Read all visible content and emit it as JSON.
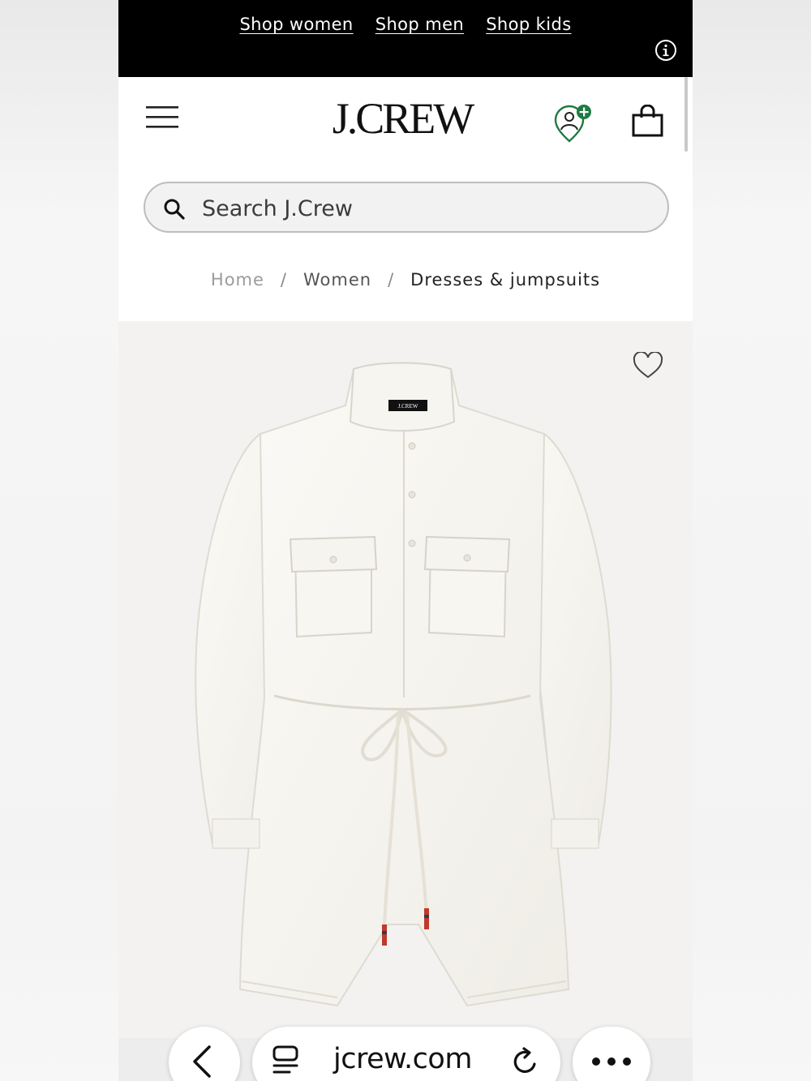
{
  "promo": {
    "links": [
      "Shop women",
      "Shop men",
      "Shop kids"
    ]
  },
  "header": {
    "logo": "J.CREW"
  },
  "search": {
    "placeholder": "Search J.Crew"
  },
  "breadcrumb": {
    "home": "Home",
    "women": "Women",
    "current": "Dresses & jumpsuits",
    "separator": "/"
  },
  "product": {
    "label_tag": "J.CREW"
  },
  "browser": {
    "url": "jcrew.com"
  },
  "colors": {
    "promo_bg": "#000000",
    "account_badge": "#1f7a43",
    "product_bg": "#f3f2f1"
  },
  "icons": [
    "info-icon",
    "menu-icon",
    "account-icon",
    "bag-icon",
    "search-icon",
    "wishlist-heart-icon",
    "back-chevron-icon",
    "tabs-icon",
    "reload-icon",
    "more-dots-icon"
  ]
}
